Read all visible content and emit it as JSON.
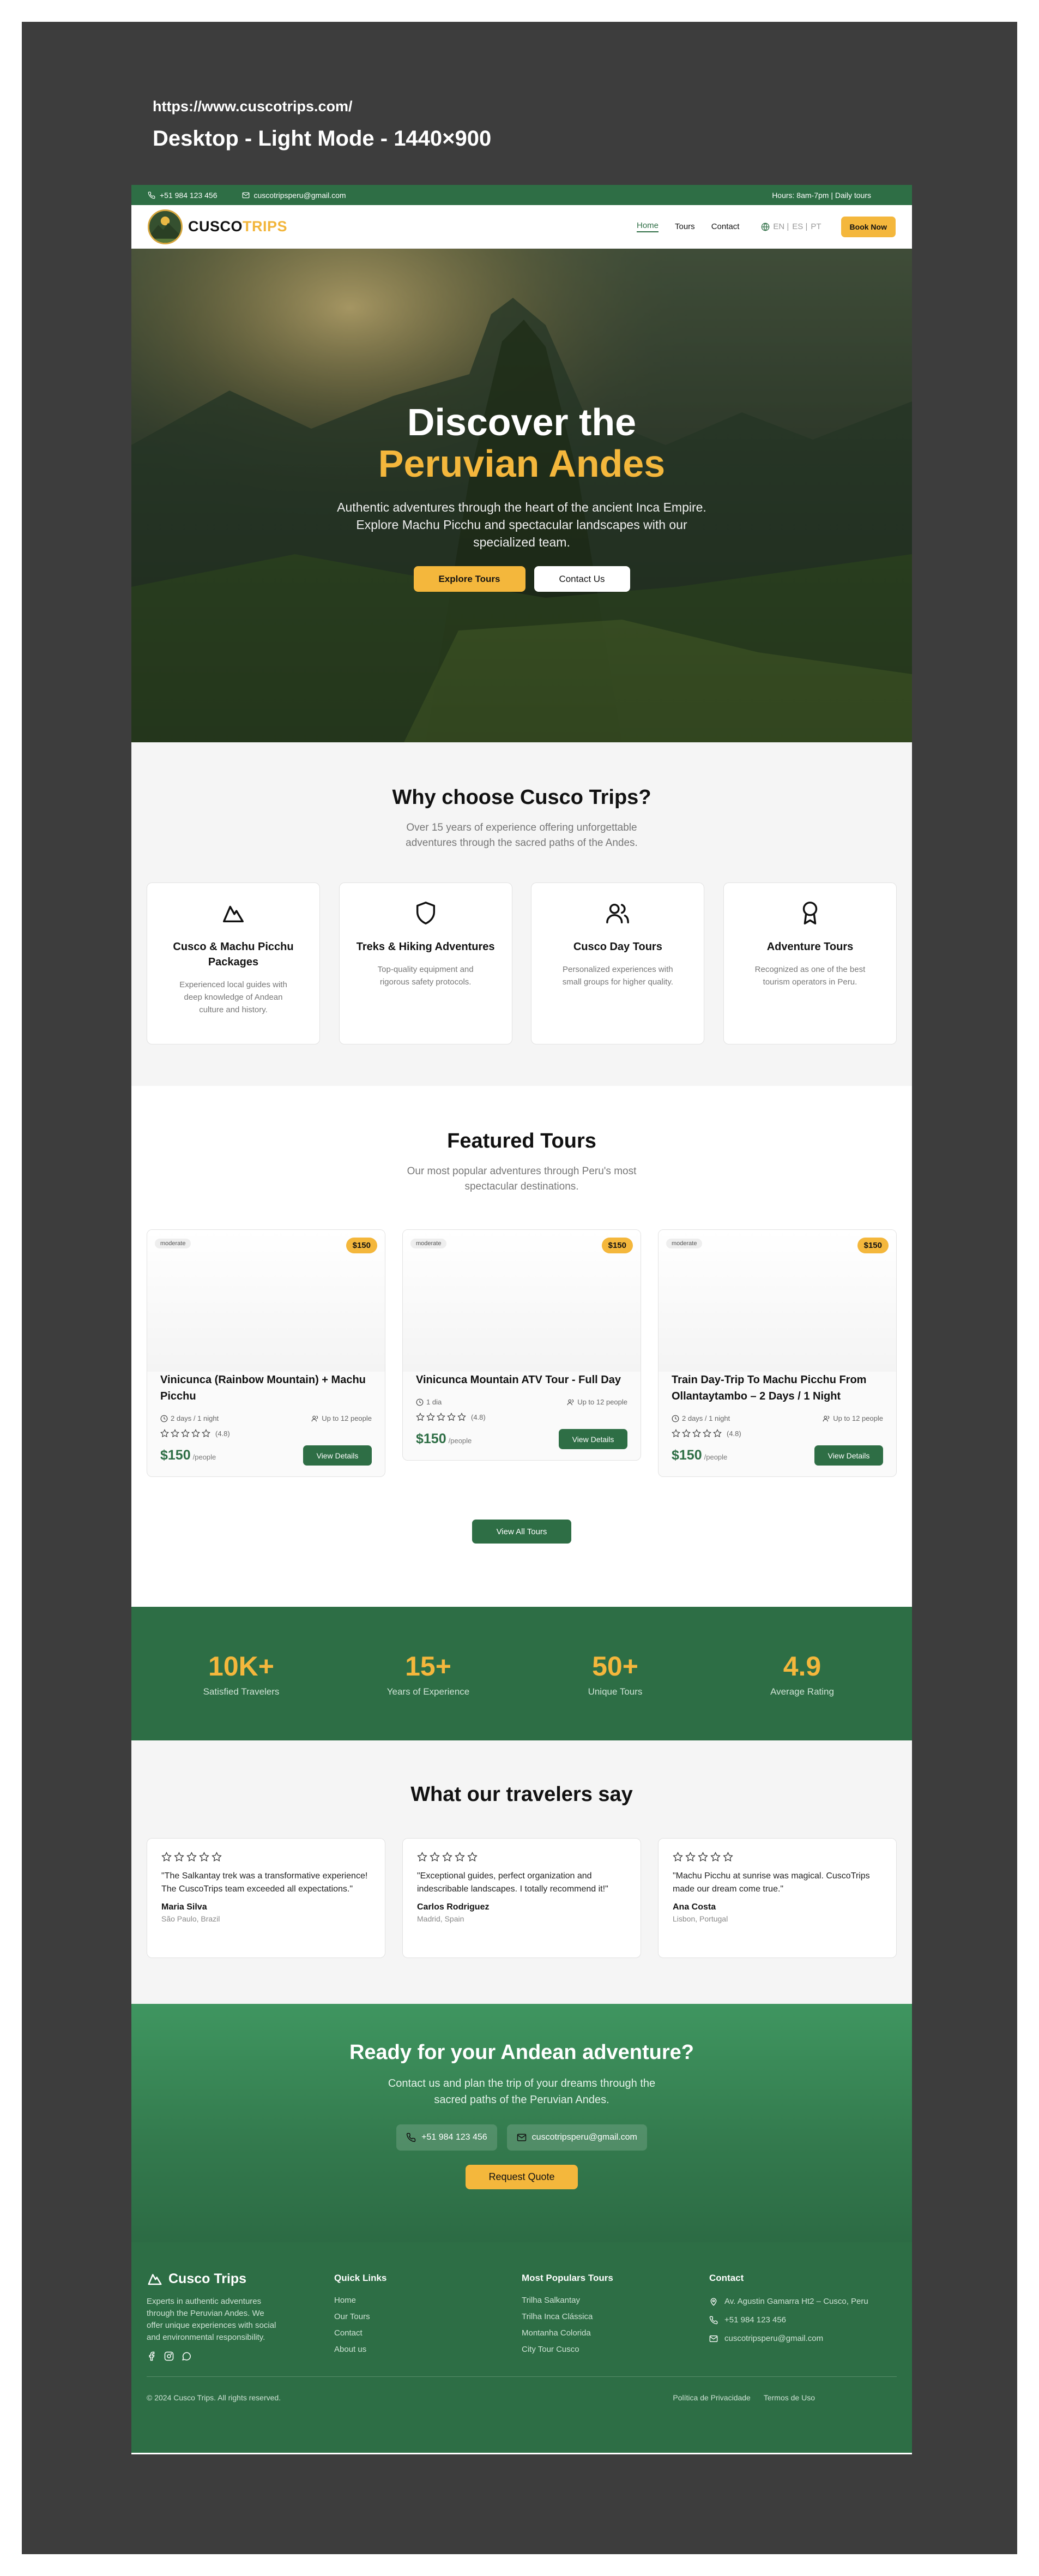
{
  "canvas": {
    "url": "https://www.cuscotrips.com/",
    "mode_label": "Desktop - Light Mode - 1440×900"
  },
  "topbar": {
    "phone": "+51 984 123 456",
    "email": "cuscotripsperu@gmail.com",
    "hours": "Hours: 8am-7pm | Daily tours"
  },
  "nav": {
    "logo_part1": "CUSCO",
    "logo_part2": "TRIPS",
    "links": [
      "Home",
      "Tours",
      "Contact"
    ],
    "langs": [
      "EN |",
      "ES |",
      "PT"
    ],
    "book_label": "Book Now"
  },
  "hero": {
    "title_line1": "Discover the",
    "title_line2": "Peruvian Andes",
    "subtitle": "Authentic adventures through the heart of the ancient Inca Empire. Explore Machu Picchu and spectacular landscapes with our specialized team.",
    "primary_cta": "Explore Tours",
    "secondary_cta": "Contact Us"
  },
  "why": {
    "title": "Why choose Cusco Trips?",
    "subtitle": "Over 15 years of experience offering unforgettable adventures through the sacred paths of the Andes.",
    "cards": [
      {
        "icon": "mountain-icon",
        "title": "Cusco & Machu Picchu Packages",
        "text": "Experienced local guides with deep knowledge of Andean culture and history."
      },
      {
        "icon": "shield-icon",
        "title": "Treks & Hiking Adventures",
        "text": "Top-quality equipment and rigorous safety protocols."
      },
      {
        "icon": "users-icon",
        "title": "Cusco Day Tours",
        "text": "Personalized experiences with small groups for higher quality."
      },
      {
        "icon": "award-icon",
        "title": "Adventure Tours",
        "text": "Recognized as one of the best tourism operators in Peru."
      }
    ]
  },
  "featured": {
    "title": "Featured Tours",
    "subtitle": "Our most popular adventures through Peru's most spectacular destinations.",
    "tours": [
      {
        "tag": "moderate",
        "badge": "$150",
        "title": "Vinicunca (Rainbow Mountain) + Machu Picchu",
        "duration": "2 days / 1 night",
        "group": "Up to 12 people",
        "rating": "(4.8)",
        "price": "$150",
        "per": "/people",
        "button": "View Details"
      },
      {
        "tag": "moderate",
        "badge": "$150",
        "title": "Vinicunca Mountain ATV Tour - Full Day",
        "duration": "1 dia",
        "group": "Up to 12 people",
        "rating": "(4.8)",
        "price": "$150",
        "per": "/people",
        "button": "View Details"
      },
      {
        "tag": "moderate",
        "badge": "$150",
        "title": "Train Day-Trip To Machu Picchu From Ollantaytambo – 2 Days / 1 Night",
        "duration": "2 days / 1 night",
        "group": "Up to 12 people",
        "rating": "(4.8)",
        "price": "$150",
        "per": "/people",
        "button": "View Details"
      }
    ],
    "all_button": "View All Tours"
  },
  "stats": [
    {
      "value": "10K+",
      "label": "Satisfied Travelers"
    },
    {
      "value": "15+",
      "label": "Years of Experience"
    },
    {
      "value": "50+",
      "label": "Unique Tours"
    },
    {
      "value": "4.9",
      "label": "Average Rating"
    }
  ],
  "testimonials": {
    "title": "What our travelers say",
    "items": [
      {
        "quote": "\"The Salkantay trek was a transformative experience! The CuscoTrips team exceeded all expectations.\"",
        "name": "Maria Silva",
        "location": "São Paulo, Brazil"
      },
      {
        "quote": "\"Exceptional guides, perfect organization and indescribable landscapes. I totally recommend it!\"",
        "name": "Carlos Rodriguez",
        "location": "Madrid, Spain"
      },
      {
        "quote": "\"Machu Picchu at sunrise was magical. CuscoTrips made our dream come true.\"",
        "name": "Ana Costa",
        "location": "Lisbon, Portugal"
      }
    ]
  },
  "cta": {
    "title": "Ready for your Andean adventure?",
    "subtitle": "Contact us and plan the trip of your dreams through the sacred paths of the Peruvian Andes.",
    "phone": "+51 984 123 456",
    "email": "cuscotripsperu@gmail.com",
    "button": "Request Quote"
  },
  "footer": {
    "brand": "Cusco Trips",
    "description": "Experts in authentic adventures through the Peruvian Andes. We offer unique experiences with social and environmental responsibility.",
    "quick_links_title": "Quick Links",
    "quick_links": [
      "Home",
      "Our Tours",
      "Contact",
      "About us"
    ],
    "popular_title": "Most Populars Tours",
    "popular": [
      "Trilha Salkantay",
      "Trilha Inca Clássica",
      "Montanha Colorida",
      "City Tour Cusco"
    ],
    "contact_title": "Contact",
    "address": "Av. Agustin Gamarra Ht2 – Cusco, Peru",
    "phone": "+51 984 123 456",
    "email": "cuscotripsperu@gmail.com",
    "copyright": "© 2024 Cusco Trips. All rights reserved.",
    "privacy": "Política de Privacidade",
    "terms": "Termos de Uso"
  },
  "colors": {
    "brand_green": "#2e6e45",
    "accent_yellow": "#f4b73c",
    "canvas_dark": "#3d3d3d"
  }
}
